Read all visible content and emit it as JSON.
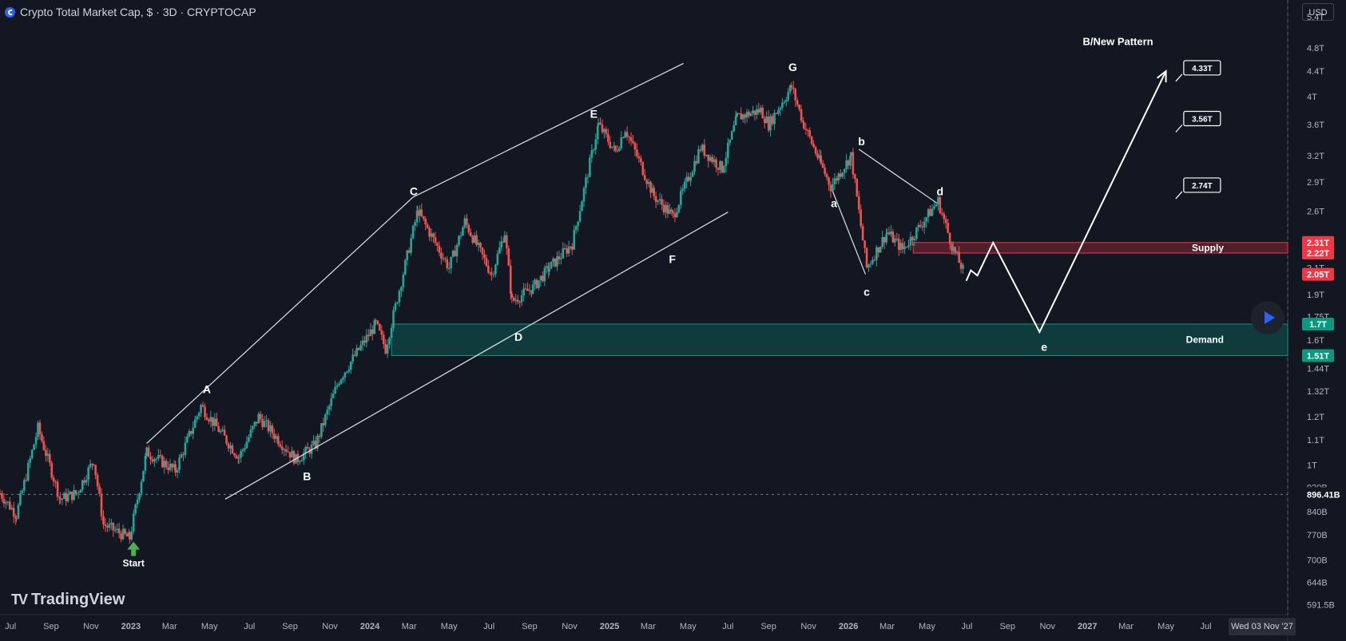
{
  "header": {
    "title": "Crypto Total Market Cap, $ · 3D · CRYPTOCAP"
  },
  "currency_button": "USD",
  "logo_text": "TradingView",
  "date_readout": "Wed 03 Nov '27",
  "colors": {
    "background": "#131722",
    "up": "#26a69a",
    "down": "#ef5350",
    "supply": "#f23645",
    "demand": "#089981",
    "drawing": "#e0e3eb"
  },
  "chart_data": {
    "type": "candlestick",
    "title": "Crypto Total Market Cap, $ · 3D · CRYPTOCAP",
    "scale": "log",
    "xlim": [
      "2022-06-15",
      "2027-11-03"
    ],
    "ylim": [
      0.57,
      5.75
    ],
    "x_ticks": [
      "Jul",
      "Sep",
      "Nov",
      "2023",
      "Mar",
      "May",
      "Jul",
      "Sep",
      "Nov",
      "2024",
      "Mar",
      "May",
      "Jul",
      "Sep",
      "Nov",
      "2025",
      "Mar",
      "May",
      "Jul",
      "Sep",
      "Nov",
      "2026",
      "Mar",
      "May",
      "Jul",
      "Sep",
      "Nov",
      "2027",
      "Mar",
      "May",
      "Jul"
    ],
    "x_tick_dates": [
      "2022-07-01",
      "2022-09-01",
      "2022-11-01",
      "2023-01-01",
      "2023-03-01",
      "2023-05-01",
      "2023-07-01",
      "2023-09-01",
      "2023-11-01",
      "2024-01-01",
      "2024-03-01",
      "2024-05-01",
      "2024-07-01",
      "2024-09-01",
      "2024-11-01",
      "2025-01-01",
      "2025-03-01",
      "2025-05-01",
      "2025-07-01",
      "2025-09-01",
      "2025-11-01",
      "2026-01-01",
      "2026-03-01",
      "2026-05-01",
      "2026-07-01",
      "2026-09-01",
      "2026-11-01",
      "2027-01-01",
      "2027-03-01",
      "2027-05-01",
      "2027-07-01"
    ],
    "y_ticks": [
      {
        "label": "5.4T",
        "v": 5.4
      },
      {
        "label": "4.8T",
        "v": 4.8
      },
      {
        "label": "4.4T",
        "v": 4.4
      },
      {
        "label": "4T",
        "v": 4.0
      },
      {
        "label": "3.6T",
        "v": 3.6
      },
      {
        "label": "3.2T",
        "v": 3.2
      },
      {
        "label": "2.9T",
        "v": 2.9
      },
      {
        "label": "2.6T",
        "v": 2.6
      },
      {
        "label": "2.1T",
        "v": 2.1
      },
      {
        "label": "1.9T",
        "v": 1.9
      },
      {
        "label": "1.75T",
        "v": 1.75
      },
      {
        "label": "1.6T",
        "v": 1.6
      },
      {
        "label": "1.44T",
        "v": 1.44
      },
      {
        "label": "1.32T",
        "v": 1.32
      },
      {
        "label": "1.2T",
        "v": 1.2
      },
      {
        "label": "1.1T",
        "v": 1.1
      },
      {
        "label": "1T",
        "v": 1.0
      },
      {
        "label": "920B",
        "v": 0.92
      },
      {
        "label": "840B",
        "v": 0.84
      },
      {
        "label": "770B",
        "v": 0.77
      },
      {
        "label": "700B",
        "v": 0.7
      },
      {
        "label": "644B",
        "v": 0.644
      },
      {
        "label": "591.5B",
        "v": 0.5915
      }
    ],
    "price_line": {
      "label": "896.41B",
      "v": 0.896
    },
    "price_tags": [
      {
        "label": "2.31T",
        "v": 2.31,
        "kind": "supply"
      },
      {
        "label": "2.22T",
        "v": 2.22,
        "kind": "supply"
      },
      {
        "label": "2.05T",
        "v": 2.05,
        "kind": "supply"
      },
      {
        "label": "1.7T",
        "v": 1.7,
        "kind": "demand"
      },
      {
        "label": "1.51T",
        "v": 1.51,
        "kind": "demand"
      }
    ],
    "zones": [
      {
        "label": "Supply",
        "from": 2.22,
        "to": 2.31,
        "start": "2026-04-10",
        "end": "2027-11-03",
        "color": "#f23645"
      },
      {
        "label": "Demand",
        "from": 1.51,
        "to": 1.7,
        "start": "2024-02-03",
        "end": "2027-11-03",
        "color": "#089981"
      }
    ],
    "wave_labels": [
      {
        "text": "Start",
        "date": "2023-01-05",
        "v": 0.7
      },
      {
        "text": "A",
        "date": "2023-04-27",
        "v": 1.33
      },
      {
        "text": "B",
        "date": "2023-09-27",
        "v": 0.96
      },
      {
        "text": "C",
        "date": "2024-03-08",
        "v": 2.8
      },
      {
        "text": "D",
        "date": "2024-08-15",
        "v": 1.62
      },
      {
        "text": "E",
        "date": "2024-12-08",
        "v": 3.75
      },
      {
        "text": "F",
        "date": "2025-04-07",
        "v": 2.17
      },
      {
        "text": "G",
        "date": "2025-10-08",
        "v": 4.47
      },
      {
        "text": "a",
        "date": "2025-12-10",
        "v": 2.68
      },
      {
        "text": "b",
        "date": "2026-01-21",
        "v": 3.38
      },
      {
        "text": "c",
        "date": "2026-01-29",
        "v": 1.92
      },
      {
        "text": "d",
        "date": "2026-05-21",
        "v": 2.8
      },
      {
        "text": "e",
        "date": "2026-10-27",
        "v": 1.56
      }
    ],
    "channel_lines": [
      {
        "from": {
          "date": "2023-01-25",
          "v": 1.085
        },
        "to": {
          "date": "2024-03-07",
          "v": 2.74
        }
      },
      {
        "from": {
          "date": "2024-03-07",
          "v": 2.74
        },
        "to": {
          "date": "2025-04-24",
          "v": 4.53
        }
      },
      {
        "from": {
          "date": "2023-05-25",
          "v": 0.88
        },
        "to": {
          "date": "2025-07-01",
          "v": 2.59
        }
      },
      {
        "from": {
          "date": "2025-12-08",
          "v": 2.8
        },
        "to": {
          "date": "2026-01-27",
          "v": 2.05
        }
      },
      {
        "from": {
          "date": "2026-01-17",
          "v": 3.28
        },
        "to": {
          "date": "2026-05-16",
          "v": 2.68
        }
      }
    ],
    "projection_path": [
      {
        "date": "2026-06-30",
        "v": 2.0
      },
      {
        "date": "2026-07-07",
        "v": 2.08
      },
      {
        "date": "2026-07-17",
        "v": 2.04
      },
      {
        "date": "2026-08-10",
        "v": 2.31
      },
      {
        "date": "2026-10-20",
        "v": 1.65
      },
      {
        "date": "2027-05-01",
        "v": 4.4
      }
    ],
    "pattern_label": "B/New Pattern",
    "targets": [
      {
        "label": "4.33T",
        "date": "2027-05-16",
        "v": 4.26
      },
      {
        "label": "3.56T",
        "date": "2027-05-16",
        "v": 3.52
      },
      {
        "label": "2.74T",
        "date": "2027-05-16",
        "v": 2.74
      }
    ],
    "swing_points": [
      {
        "date": "2022-06-15",
        "v": 0.9
      },
      {
        "date": "2022-07-10",
        "v": 0.83
      },
      {
        "date": "2022-08-12",
        "v": 1.15
      },
      {
        "date": "2022-09-15",
        "v": 0.88
      },
      {
        "date": "2022-10-10",
        "v": 0.9
      },
      {
        "date": "2022-11-05",
        "v": 1.02
      },
      {
        "date": "2022-11-20",
        "v": 0.8
      },
      {
        "date": "2022-12-30",
        "v": 0.76
      },
      {
        "date": "2023-01-25",
        "v": 1.05
      },
      {
        "date": "2023-03-10",
        "v": 0.98
      },
      {
        "date": "2023-04-18",
        "v": 1.25
      },
      {
        "date": "2023-06-15",
        "v": 1.03
      },
      {
        "date": "2023-07-15",
        "v": 1.2
      },
      {
        "date": "2023-09-10",
        "v": 1.02
      },
      {
        "date": "2023-10-10",
        "v": 1.08
      },
      {
        "date": "2023-11-15",
        "v": 1.38
      },
      {
        "date": "2024-01-10",
        "v": 1.7
      },
      {
        "date": "2024-01-25",
        "v": 1.55
      },
      {
        "date": "2024-03-14",
        "v": 2.6
      },
      {
        "date": "2024-05-01",
        "v": 2.1
      },
      {
        "date": "2024-05-25",
        "v": 2.5
      },
      {
        "date": "2024-07-05",
        "v": 2.05
      },
      {
        "date": "2024-07-25",
        "v": 2.4
      },
      {
        "date": "2024-08-05",
        "v": 1.85
      },
      {
        "date": "2024-09-06",
        "v": 1.95
      },
      {
        "date": "2024-10-01",
        "v": 2.1
      },
      {
        "date": "2024-11-05",
        "v": 2.3
      },
      {
        "date": "2024-12-15",
        "v": 3.6
      },
      {
        "date": "2025-01-10",
        "v": 3.25
      },
      {
        "date": "2025-01-25",
        "v": 3.55
      },
      {
        "date": "2025-03-10",
        "v": 2.75
      },
      {
        "date": "2025-04-08",
        "v": 2.55
      },
      {
        "date": "2025-05-20",
        "v": 3.3
      },
      {
        "date": "2025-06-22",
        "v": 3.05
      },
      {
        "date": "2025-07-15",
        "v": 3.7
      },
      {
        "date": "2025-08-20",
        "v": 3.8
      },
      {
        "date": "2025-09-01",
        "v": 3.6
      },
      {
        "date": "2025-10-06",
        "v": 4.15
      },
      {
        "date": "2025-10-25",
        "v": 3.6
      },
      {
        "date": "2025-11-20",
        "v": 3.1
      },
      {
        "date": "2025-12-05",
        "v": 2.85
      },
      {
        "date": "2026-01-05",
        "v": 3.2
      },
      {
        "date": "2026-01-29",
        "v": 2.1
      },
      {
        "date": "2026-03-01",
        "v": 2.4
      },
      {
        "date": "2026-03-25",
        "v": 2.25
      },
      {
        "date": "2026-05-18",
        "v": 2.7
      },
      {
        "date": "2026-06-10",
        "v": 2.25
      },
      {
        "date": "2026-06-28",
        "v": 2.05
      }
    ]
  }
}
